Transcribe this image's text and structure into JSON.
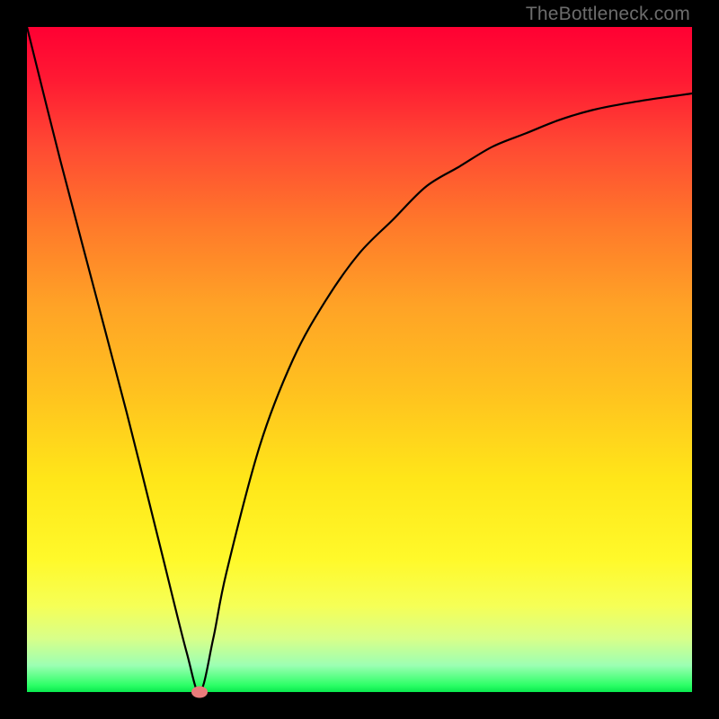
{
  "watermark": "TheBottleneck.com",
  "colors": {
    "curve": "#000000",
    "marker": "#ea7b7b",
    "frame": "#000000"
  },
  "chart_data": {
    "type": "line",
    "title": "",
    "xlabel": "",
    "ylabel": "",
    "xlim": [
      0,
      100
    ],
    "ylim": [
      0,
      100
    ],
    "axes_visible": false,
    "grid": false,
    "series": [
      {
        "name": "bottleneck-curve",
        "x": [
          0,
          5,
          10,
          15,
          20,
          24,
          26,
          28,
          30,
          35,
          40,
          45,
          50,
          55,
          60,
          65,
          70,
          75,
          80,
          85,
          90,
          95,
          100
        ],
        "values": [
          100,
          80,
          61,
          42,
          22,
          6,
          0,
          8,
          18,
          37,
          50,
          59,
          66,
          71,
          76,
          79,
          82,
          84,
          86,
          87.5,
          88.5,
          89.3,
          90
        ]
      }
    ],
    "marker": {
      "x": 26,
      "y": 0
    },
    "background_gradient": {
      "top": "#ff0033",
      "mid": "#ffe619",
      "bottom": "#09e84e"
    }
  }
}
